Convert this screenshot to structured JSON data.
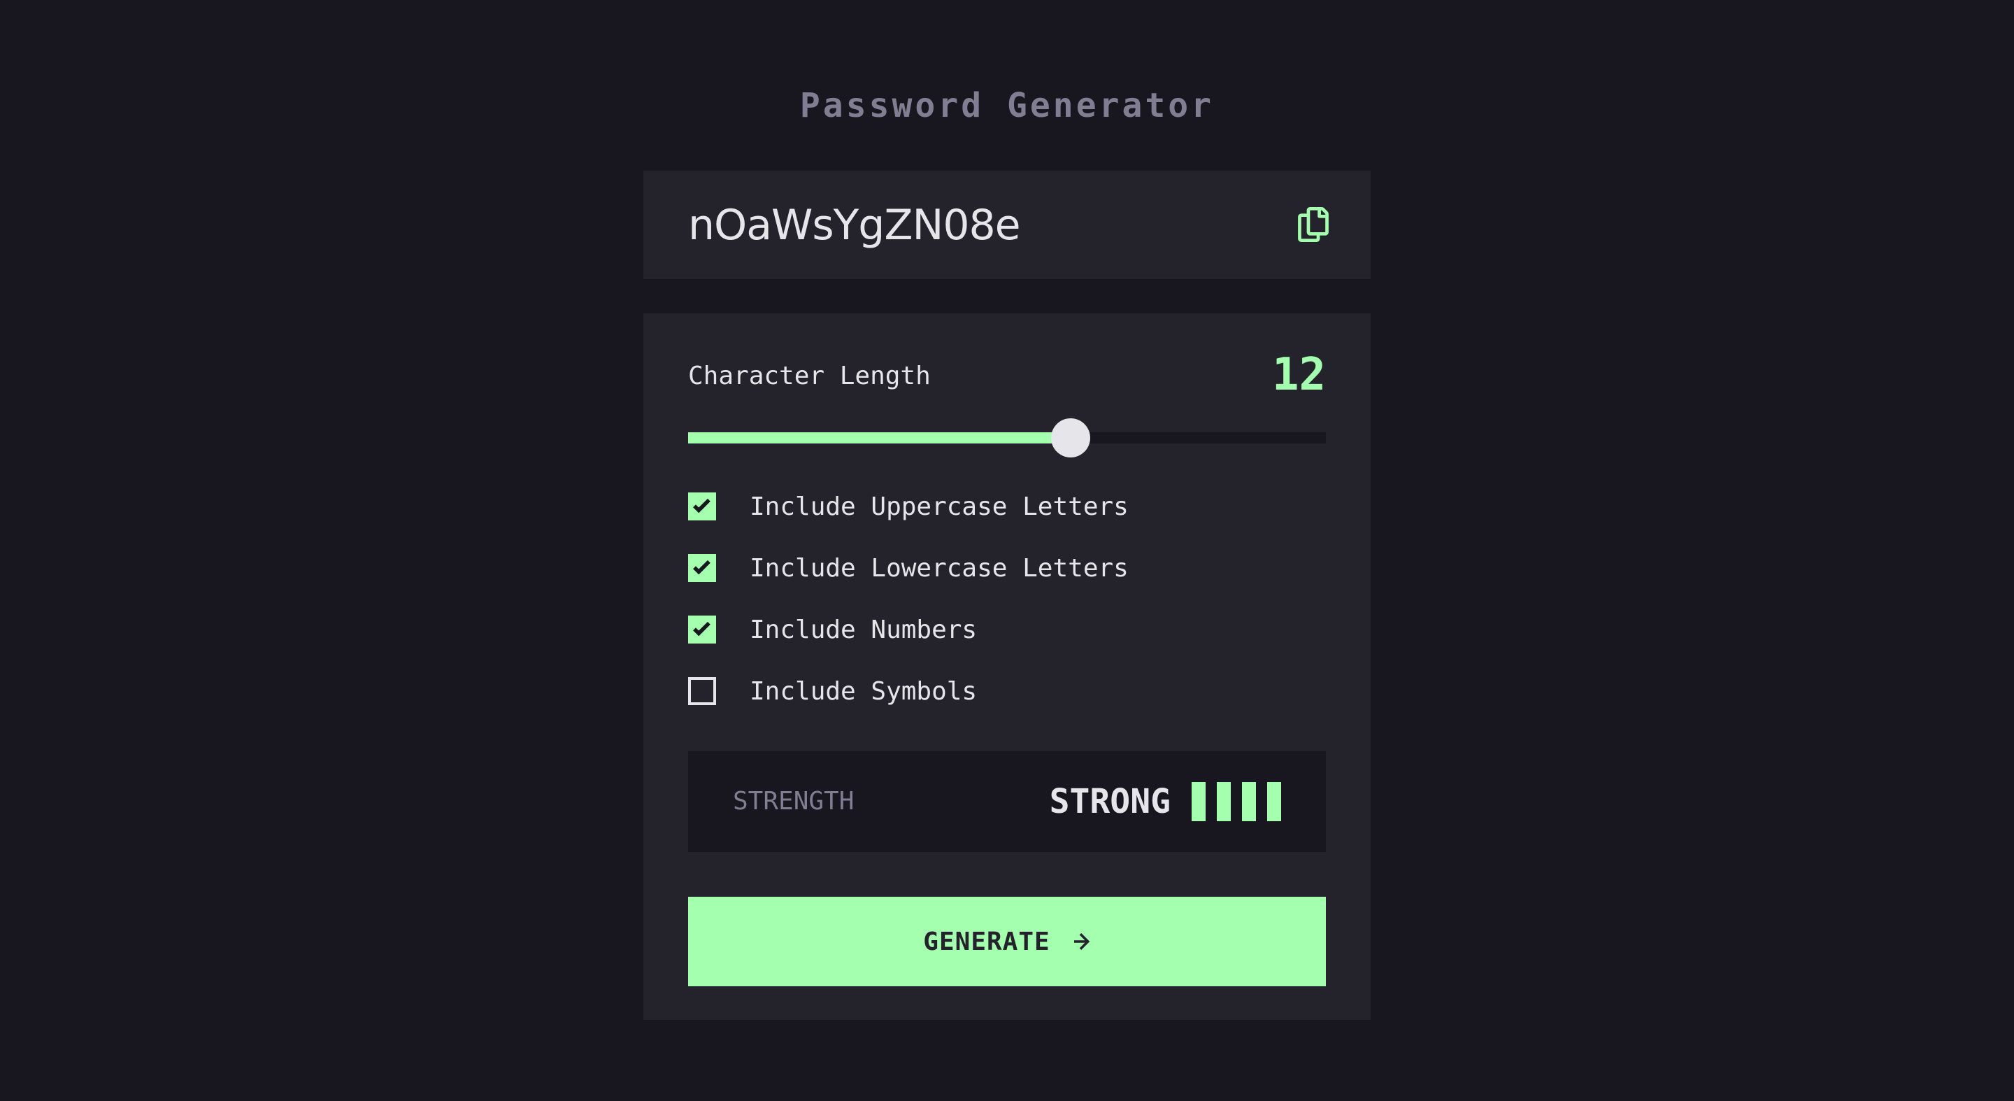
{
  "app": {
    "title": "Password Generator"
  },
  "password": {
    "value": "nOaWsYgZN08e",
    "copy_icon": "copy-icon"
  },
  "length": {
    "label": "Character Length",
    "value": "12",
    "slider_value": 12,
    "slider_min": 0,
    "slider_max": 20
  },
  "options": [
    {
      "label": "Include Uppercase Letters",
      "checked": true
    },
    {
      "label": "Include Lowercase Letters",
      "checked": true
    },
    {
      "label": "Include Numbers",
      "checked": true
    },
    {
      "label": "Include Symbols",
      "checked": false
    }
  ],
  "strength": {
    "label": "STRENGTH",
    "level": "STRONG",
    "bars_filled": 4,
    "bars_total": 4
  },
  "generate": {
    "label": "GENERATE",
    "icon": "arrow-right-icon"
  },
  "colors": {
    "background": "#18171f",
    "panel": "#24232c",
    "accent": "#a4ffaf",
    "text": "#e6e5ea",
    "muted": "#817d92"
  }
}
